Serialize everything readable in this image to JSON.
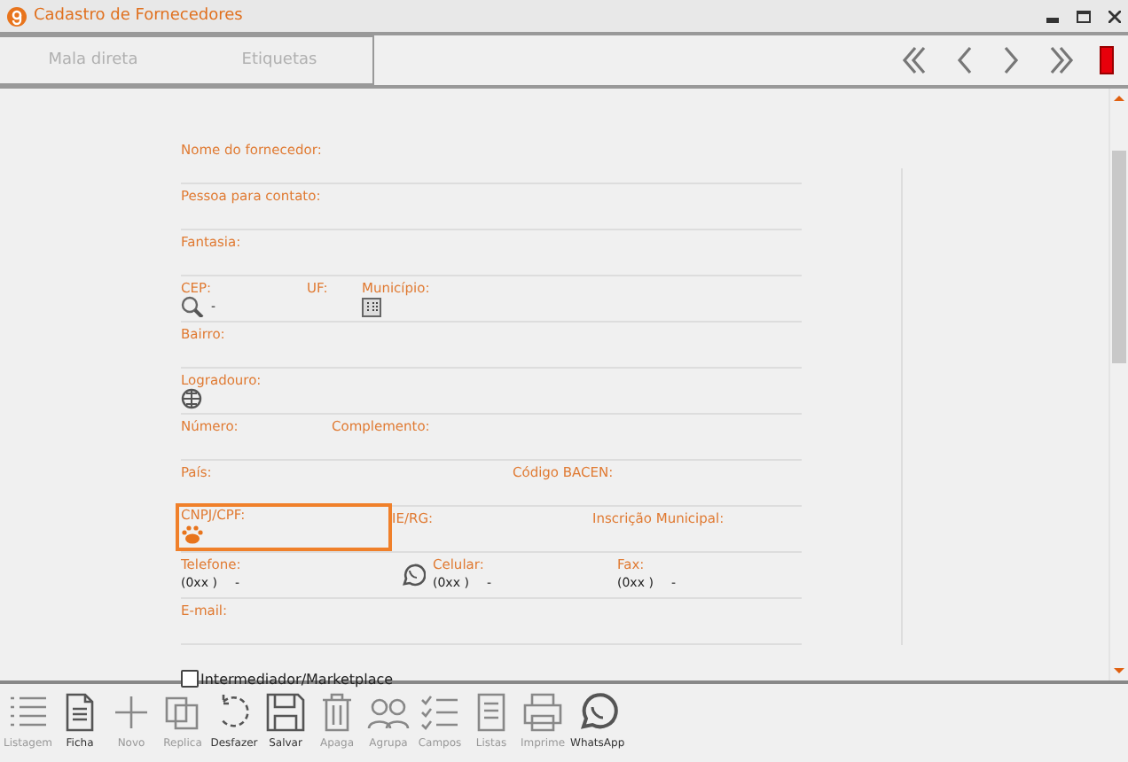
{
  "window": {
    "title": "Cadastro de Fornecedores"
  },
  "tabs": [
    {
      "label": "Mala direta",
      "selected": false
    },
    {
      "label": "Etiquetas",
      "selected": false
    }
  ],
  "nav": [
    {
      "kind": "first"
    },
    {
      "kind": "prev"
    },
    {
      "kind": "next"
    },
    {
      "kind": "last"
    },
    {
      "kind": "status"
    }
  ],
  "form": {
    "rows": [
      {
        "fields": [
          {
            "label": "Nome do fornecedor:",
            "kind": "text",
            "focused": false
          }
        ]
      },
      {
        "fields": [
          {
            "label": "Pessoa para contato:",
            "kind": "text",
            "focused": false
          }
        ]
      },
      {
        "fields": [
          {
            "label": "Fantasia:",
            "kind": "text",
            "focused": false
          }
        ]
      },
      {
        "fields": [
          {
            "label": "CEP:",
            "kind": "cep",
            "value": "-",
            "focused": false
          },
          {
            "label": "UF:",
            "kind": "text",
            "focused": false
          },
          {
            "label": "Município:",
            "kind": "city",
            "focused": false
          }
        ]
      },
      {
        "fields": [
          {
            "label": "Bairro:",
            "kind": "text",
            "focused": false
          }
        ]
      },
      {
        "fields": [
          {
            "label": "Logradouro:",
            "kind": "address",
            "focused": false
          }
        ]
      },
      {
        "fields": [
          {
            "label": "Número:",
            "kind": "text",
            "focused": false
          },
          {
            "label": "Complemento:",
            "kind": "text",
            "focused": false
          }
        ]
      },
      {
        "fields": [
          {
            "label": "País:",
            "kind": "text",
            "focused": false
          },
          {
            "label": "Código BACEN:",
            "kind": "text",
            "focused": false
          }
        ]
      },
      {
        "fields": [
          {
            "label": "CNPJ/CPF:",
            "kind": "document",
            "focused": true
          },
          {
            "label": "IE/RG:",
            "kind": "text",
            "focused": false
          },
          {
            "label": "Inscrição Municipal:",
            "kind": "text",
            "focused": false
          }
        ]
      },
      {
        "fields": [
          {
            "label": "Telefone:",
            "kind": "phone",
            "area": "(0xx )",
            "value": "-",
            "focused": false
          },
          {
            "label": "Celular:",
            "kind": "mobile",
            "area": "(0xx )",
            "value": "-",
            "focused": false
          },
          {
            "label": "Fax:",
            "kind": "phone",
            "area": "(0xx )",
            "value": "-",
            "focused": false
          }
        ]
      },
      {
        "fields": [
          {
            "label": "E-mail:",
            "kind": "text",
            "focused": false
          }
        ]
      }
    ],
    "checkbox": {
      "label": "Intermediador/Marketplace",
      "checked": false
    }
  },
  "toolbar": [
    {
      "label": "Listagem",
      "kind": "list",
      "disabled": true
    },
    {
      "label": "Ficha",
      "kind": "sheet",
      "disabled": false
    },
    {
      "label": "Novo",
      "kind": "plus",
      "disabled": true
    },
    {
      "label": "Replica",
      "kind": "copy",
      "disabled": true
    },
    {
      "label": "Desfazer",
      "kind": "undo",
      "disabled": false
    },
    {
      "label": "Salvar",
      "kind": "save",
      "disabled": false
    },
    {
      "label": "Apaga",
      "kind": "trash",
      "disabled": true
    },
    {
      "label": "Agrupa",
      "kind": "group",
      "disabled": true
    },
    {
      "label": "Campos",
      "kind": "checklist",
      "disabled": true
    },
    {
      "label": "Listas",
      "kind": "lists",
      "disabled": true
    },
    {
      "label": "Imprime",
      "kind": "print",
      "disabled": true
    },
    {
      "label": "WhatsApp",
      "kind": "whatsapp",
      "disabled": false
    }
  ]
}
